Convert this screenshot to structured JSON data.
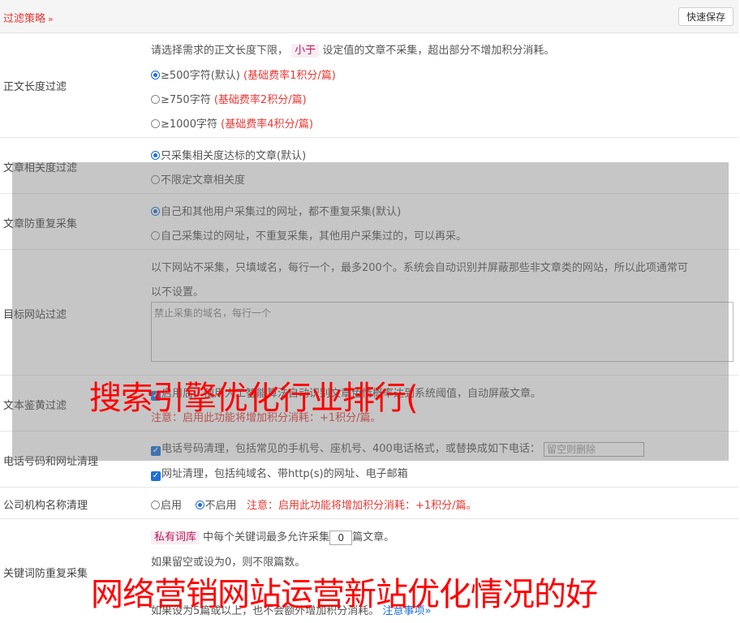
{
  "topbar": {
    "title": "过滤策略",
    "chevron": "»",
    "save_label": "快速保存"
  },
  "length_filter": {
    "label": "正文长度过滤",
    "desc_before": "请选择需求的正文长度下限，",
    "desc_tag": "小于",
    "desc_after": "设定值的文章不采集，超出部分不增加积分消耗。",
    "options": [
      {
        "text": "≥500字符(默认)",
        "note": "(基础费率1积分/篇)",
        "selected": true
      },
      {
        "text": "≥750字符",
        "note": "(基础费率2积分/篇)",
        "selected": false
      },
      {
        "text": "≥1000字符",
        "note": "(基础费率4积分/篇)",
        "selected": false
      }
    ]
  },
  "relevance_filter": {
    "label": "文章相关度过滤",
    "options": [
      "只采集相关度达标的文章(默认)",
      "不限定文章相关度"
    ]
  },
  "dedup_filter": {
    "label": "文章防重复采集",
    "options": [
      "自己和其他用户采集过的网址，都不重复采集(默认)",
      "自己采集过的网址，不重复采集，其他用户采集过的，可以再采。"
    ]
  },
  "site_filter": {
    "label": "目标网站过滤",
    "desc_line1": "以下网站不采集，只填域名，每行一个，最多200个。系统会自动识别并屏蔽那些非文章类的网站，所以此项通常可",
    "desc_line2": "以不设置。",
    "placeholder": "禁止采集的域名，每行一个"
  },
  "porn_filter": {
    "label": "文本鉴黄过滤",
    "line1": "启用后，使用人工智能算法自动识别文章色情概率达到系统阈值，自动屏蔽文章。",
    "note": "注意：启用此功能将增加积分消耗：+1积分/篇。"
  },
  "contact_clean": {
    "label": "电话号码和网址清理",
    "phone_text": "电话号码清理，包括常见的手机号、座机号、400电话格式，或替换成如下电话：",
    "phone_placeholder": "留空则删除",
    "url_text": "网址清理，包括纯域名、带http(s)的网址、电子邮箱"
  },
  "org_clean": {
    "label": "公司机构名称清理",
    "enable": "启用",
    "disable": "不启用",
    "note": "注意：启用此功能将增加积分消耗：+1积分/篇。"
  },
  "keyword_dedup": {
    "label": "关键词防重复采集",
    "tag": "私有词库",
    "text_before": "中每个关键词最多允许采集",
    "value": "0",
    "text_after": "篇文章。",
    "line2": "如果留空或设为0，则不限篇数。",
    "line4": "如果设为5篇或以上，也不会额外增加积分消耗。",
    "link": "注意事项",
    "link_chevron": "»"
  },
  "watermarks": {
    "middle": "搜索引擎优化行业排行(",
    "bottom": "网络营销网站运营新站优化情况的好"
  }
}
